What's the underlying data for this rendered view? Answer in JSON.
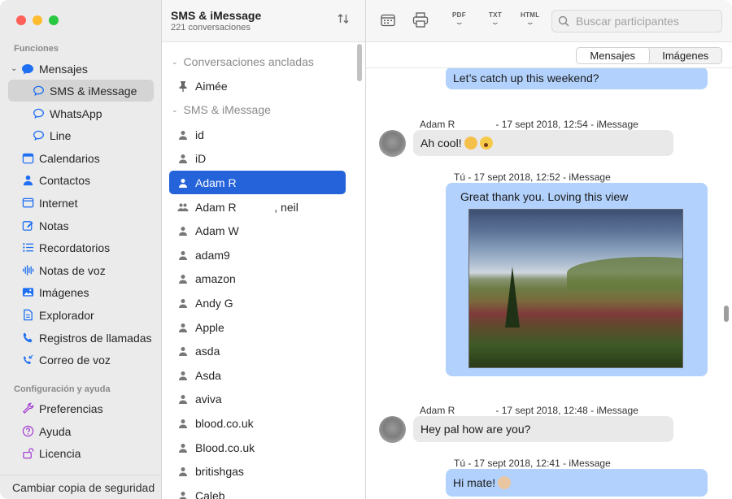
{
  "sidebar": {
    "section_functions": "Funciones",
    "items": [
      {
        "label": "Mensajes"
      },
      {
        "label": "SMS & iMessage"
      },
      {
        "label": "WhatsApp"
      },
      {
        "label": "Line"
      },
      {
        "label": "Calendarios"
      },
      {
        "label": "Contactos"
      },
      {
        "label": "Internet"
      },
      {
        "label": "Notas"
      },
      {
        "label": "Recordatorios"
      },
      {
        "label": "Notas de voz"
      },
      {
        "label": "Imágenes"
      },
      {
        "label": "Explorador"
      },
      {
        "label": "Registros de llamadas"
      },
      {
        "label": "Correo de voz"
      }
    ],
    "section_config": "Configuración y ayuda",
    "config_items": [
      {
        "label": "Preferencias"
      },
      {
        "label": "Ayuda"
      },
      {
        "label": "Licencia"
      }
    ],
    "footer": "Cambiar copia de seguridad"
  },
  "list": {
    "title": "SMS & iMessage",
    "subtitle": "221 conversaciones",
    "pinned_header": "Conversaciones ancladas",
    "pinned": [
      {
        "label": "Aimée"
      }
    ],
    "group_header": "SMS & iMessage",
    "contacts": [
      {
        "label": "id"
      },
      {
        "label": "iD"
      },
      {
        "label": "Adam R"
      },
      {
        "label": "Adam R            , neil"
      },
      {
        "label": "Adam W"
      },
      {
        "label": "adam9"
      },
      {
        "label": "amazon"
      },
      {
        "label": "Andy G"
      },
      {
        "label": "Apple"
      },
      {
        "label": "asda"
      },
      {
        "label": "Asda"
      },
      {
        "label": "aviva"
      },
      {
        "label": "blood.co.uk"
      },
      {
        "label": "Blood.co.uk"
      },
      {
        "label": "britishgas"
      },
      {
        "label": "Caleb"
      }
    ]
  },
  "toolbar": {
    "pdf": "PDF",
    "txt": "TXT",
    "html": "HTML",
    "search_placeholder": "Buscar participantes"
  },
  "tabs": {
    "messages": "Mensajes",
    "images": "Imágenes"
  },
  "chat": {
    "messages": [
      {
        "text": "Let’s catch up this weekend?"
      },
      {
        "meta": "Adam R               - 17 sept 2018, 12:54 - iMessage",
        "text": "Ah cool! "
      },
      {
        "meta": "Tú - 17 sept 2018, 12:52 - iMessage",
        "text": "Great thank you. Loving this view"
      },
      {
        "meta": "Adam R               - 17 sept 2018, 12:48 - iMessage",
        "text": "Hey pal how are you?"
      },
      {
        "meta": "Tú - 17 sept 2018, 12:41 - iMessage",
        "text": "Hi mate! "
      }
    ]
  },
  "colors": {
    "selection": "#2463d9",
    "accent": "#1e6ff1",
    "my_bubble": "#b2d2fd",
    "their_bubble": "#e9e9ea"
  }
}
